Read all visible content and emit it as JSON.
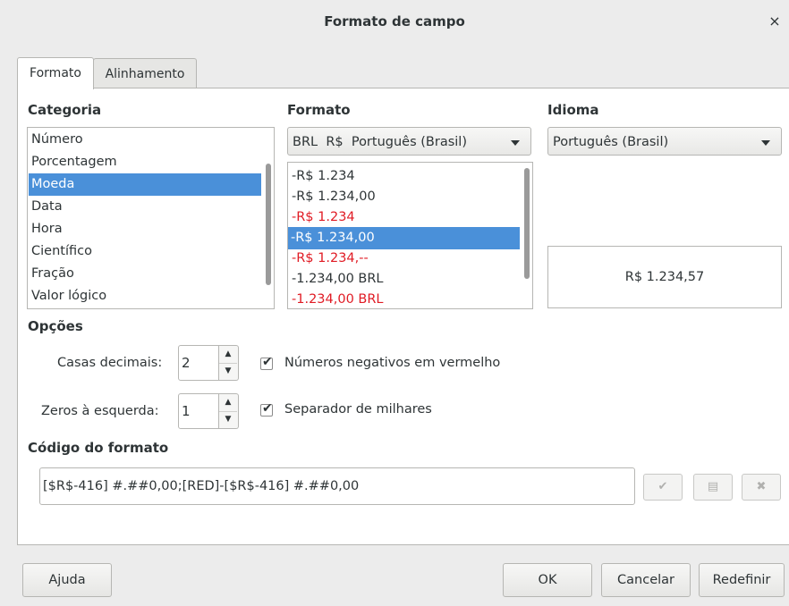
{
  "window": {
    "title": "Formato de campo",
    "close_glyph": "×"
  },
  "tabs": [
    {
      "label": "Formato",
      "active": true
    },
    {
      "label": "Alinhamento",
      "active": false
    }
  ],
  "categoria": {
    "header": "Categoria",
    "items": [
      "Número",
      "Porcentagem",
      "Moeda",
      "Data",
      "Hora",
      "Científico",
      "Fração",
      "Valor lógico"
    ],
    "selected_index": 2
  },
  "formato": {
    "header": "Formato",
    "currency_combo": "BRL  R$  Português (Brasil)",
    "items": [
      {
        "text": "-R$ 1.234",
        "red": false
      },
      {
        "text": "-R$ 1.234,00",
        "red": false
      },
      {
        "text": "-R$ 1.234",
        "red": true
      },
      {
        "text": "-R$ 1.234,00",
        "red": true
      },
      {
        "text": "-R$ 1.234,--",
        "red": true
      },
      {
        "text": "-1.234,00 BRL",
        "red": false
      },
      {
        "text": "-1.234,00 BRL",
        "red": true
      }
    ],
    "selected_index": 3
  },
  "idioma": {
    "header": "Idioma",
    "value": "Português (Brasil)"
  },
  "preview": {
    "text": "R$ 1.234,57"
  },
  "opcoes": {
    "header": "Opções",
    "casas_decimais_label": "Casas decimais:",
    "casas_decimais_value": "2",
    "zeros_label": "Zeros à esquerda:",
    "zeros_value": "1",
    "negativos_label": "Números negativos em vermelho",
    "negativos_checked": true,
    "separador_label": "Separador de milhares",
    "separador_checked": true
  },
  "codigo": {
    "header": "Código do formato",
    "value": "[$R$-416] #.##0,00;[RED]-[$R$-416] #.##0,00"
  },
  "icons": {
    "confirm": "check-icon",
    "comment": "comment-icon",
    "delete": "delete-icon"
  },
  "buttons": {
    "help": "Ajuda",
    "ok": "OK",
    "cancel": "Cancelar",
    "reset": "Redefinir"
  },
  "colors": {
    "selection": "#4a90d9",
    "negative_red": "#e01b24"
  }
}
